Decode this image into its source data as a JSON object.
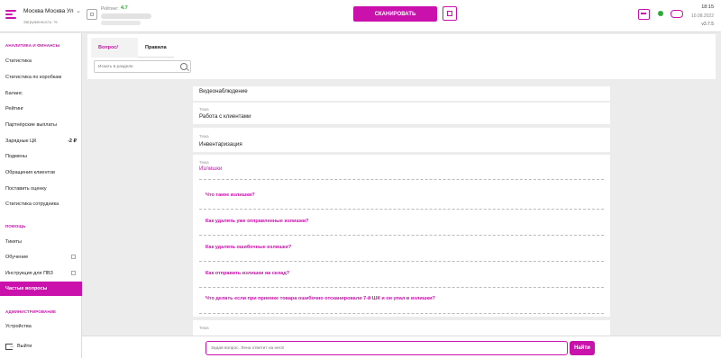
{
  "header": {
    "location": "Москва Москва Ул",
    "workload_label": "Загруженность: %",
    "rating_label": "Рейтинг:",
    "rating_value": "4.7",
    "scan_label": "СКАНИРОВАТЬ",
    "time": "18:15",
    "date": "10.08.2022",
    "version": "v3.7.5"
  },
  "sidebar": {
    "section1": "АНАЛИТИКА И ФИНАНСЫ",
    "items1": [
      {
        "label": "Статистика"
      },
      {
        "label": "Статистика по коробкам"
      },
      {
        "label": "Баланс"
      },
      {
        "label": "Рейтинг"
      },
      {
        "label": "Партнёрские выплаты"
      },
      {
        "label": "Зарядные ЦК",
        "badge": "-2 ₽"
      },
      {
        "label": "Подмены"
      },
      {
        "label": "Обращения клиентов"
      },
      {
        "label": "Поставить оценку"
      },
      {
        "label": "Статистика сотрудника"
      }
    ],
    "section2": "ПОМОЩЬ",
    "items2": [
      {
        "label": "Тикеты"
      },
      {
        "label": "Обучение"
      },
      {
        "label": "Инструкция для ПВЗ"
      },
      {
        "label": "Частые вопросы"
      }
    ],
    "section3": "АДМИНИСТРИРОВАНИЕ",
    "items3": [
      {
        "label": "Устройства"
      }
    ],
    "exit_label": "Выйти"
  },
  "tabs": [
    {
      "label": "Вопрос/Ответ"
    },
    {
      "label": "Правила"
    }
  ],
  "search": {
    "placeholder": "Искать в разделе"
  },
  "content": {
    "top_title": "Видеонаблюдение",
    "topic_label": "Тема",
    "cards": [
      {
        "title": "Работа с клиентами"
      },
      {
        "title": "Инвентаризация"
      },
      {
        "title": "Излишки"
      }
    ],
    "questions": [
      "Что такое излишки?",
      "Как удалять уже отправленные излишки?",
      "Как удалять ошибочные излишки?",
      "Как отправить излишки на склад?",
      "Что делать если при приемке товара ошибочно отсканировали 7-й ШК и он упал в излишки?"
    ],
    "next_label": "Тема"
  },
  "bottom": {
    "placeholder": "Задай вопрос. Лена ответит на него!",
    "find_label": "Найти"
  }
}
